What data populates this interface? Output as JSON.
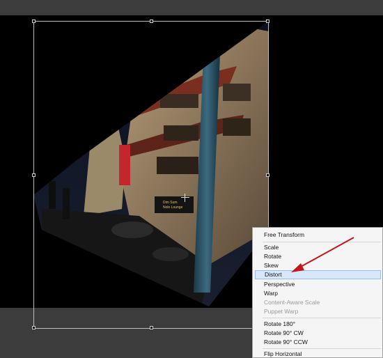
{
  "menu": {
    "items": [
      {
        "label": "Free Transform",
        "enabled": true,
        "highlighted": false
      },
      {
        "label": "Scale",
        "enabled": true,
        "highlighted": false
      },
      {
        "label": "Rotate",
        "enabled": true,
        "highlighted": false
      },
      {
        "label": "Skew",
        "enabled": true,
        "highlighted": false
      },
      {
        "label": "Distort",
        "enabled": true,
        "highlighted": true
      },
      {
        "label": "Perspective",
        "enabled": true,
        "highlighted": false
      },
      {
        "label": "Warp",
        "enabled": true,
        "highlighted": false
      },
      {
        "label": "Content-Aware Scale",
        "enabled": false,
        "highlighted": false
      },
      {
        "label": "Puppet Warp",
        "enabled": false,
        "highlighted": false
      },
      {
        "label": "Rotate 180°",
        "enabled": true,
        "highlighted": false
      },
      {
        "label": "Rotate 90° CW",
        "enabled": true,
        "highlighted": false
      },
      {
        "label": "Rotate 90° CCW",
        "enabled": true,
        "highlighted": false
      },
      {
        "label": "Flip Horizontal",
        "enabled": true,
        "highlighted": false
      }
    ]
  },
  "photo": {
    "signs": [
      "Dim Sum",
      "Nolo Lounge"
    ]
  },
  "colors": {
    "menu_highlight": "#d8e8fb",
    "annotation_arrow": "#c0161c"
  }
}
